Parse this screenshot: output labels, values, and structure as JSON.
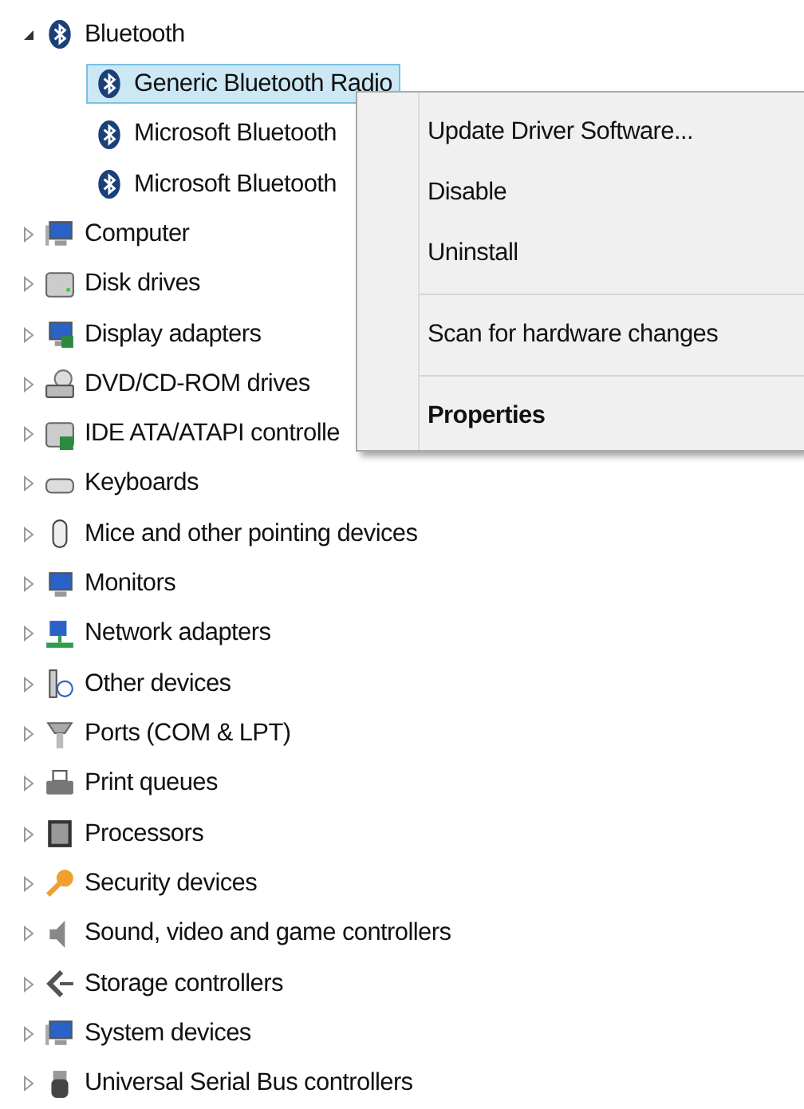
{
  "device_tree": [
    {
      "label": "Bluetooth",
      "expanded": true,
      "children": [
        {
          "label": "Generic Bluetooth Radio",
          "selected": true
        },
        {
          "label": "Microsoft Bluetooth",
          "selected": false
        },
        {
          "label": "Microsoft Bluetooth",
          "selected": false
        }
      ]
    },
    {
      "label": "Computer",
      "expanded": false
    },
    {
      "label": "Disk drives",
      "expanded": false
    },
    {
      "label": "Display adapters",
      "expanded": false
    },
    {
      "label": "DVD/CD-ROM drives",
      "expanded": false
    },
    {
      "label": "IDE ATA/ATAPI controlle",
      "expanded": false
    },
    {
      "label": "Keyboards",
      "expanded": false
    },
    {
      "label": "Mice and other pointing devices",
      "expanded": false
    },
    {
      "label": "Monitors",
      "expanded": false
    },
    {
      "label": "Network adapters",
      "expanded": false
    },
    {
      "label": "Other devices",
      "expanded": false
    },
    {
      "label": "Ports (COM & LPT)",
      "expanded": false
    },
    {
      "label": "Print queues",
      "expanded": false
    },
    {
      "label": "Processors",
      "expanded": false
    },
    {
      "label": "Security devices",
      "expanded": false
    },
    {
      "label": "Sound, video and game controllers",
      "expanded": false
    },
    {
      "label": "Storage controllers",
      "expanded": false
    },
    {
      "label": "System devices",
      "expanded": false
    },
    {
      "label": "Universal Serial Bus controllers",
      "expanded": false
    }
  ],
  "context_menu": [
    {
      "label": "Update Driver Software...",
      "kind": "item"
    },
    {
      "label": "Disable",
      "kind": "item"
    },
    {
      "label": "Uninstall",
      "kind": "item"
    },
    {
      "kind": "separator"
    },
    {
      "label": "Scan for hardware changes",
      "kind": "item"
    },
    {
      "kind": "separator"
    },
    {
      "label": "Properties",
      "kind": "default"
    }
  ]
}
